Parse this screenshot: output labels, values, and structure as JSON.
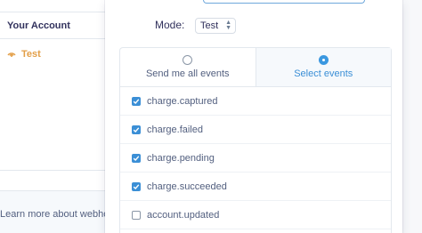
{
  "background": {
    "column_header": "Your Account",
    "account_row_label": "Test",
    "footer_text": "Learn more about webho"
  },
  "modal": {
    "mode_label": "Mode:",
    "mode_value": "Test",
    "tabs": [
      {
        "label": "Send me all events",
        "selected": false
      },
      {
        "label": "Select events",
        "selected": true
      }
    ],
    "events": [
      {
        "label": "charge.captured",
        "checked": true
      },
      {
        "label": "charge.failed",
        "checked": true
      },
      {
        "label": "charge.pending",
        "checked": true
      },
      {
        "label": "charge.succeeded",
        "checked": true
      },
      {
        "label": "account.updated",
        "checked": false
      }
    ]
  },
  "colors": {
    "accent": "#3b8fd6",
    "test_mode": "#e39f48"
  }
}
